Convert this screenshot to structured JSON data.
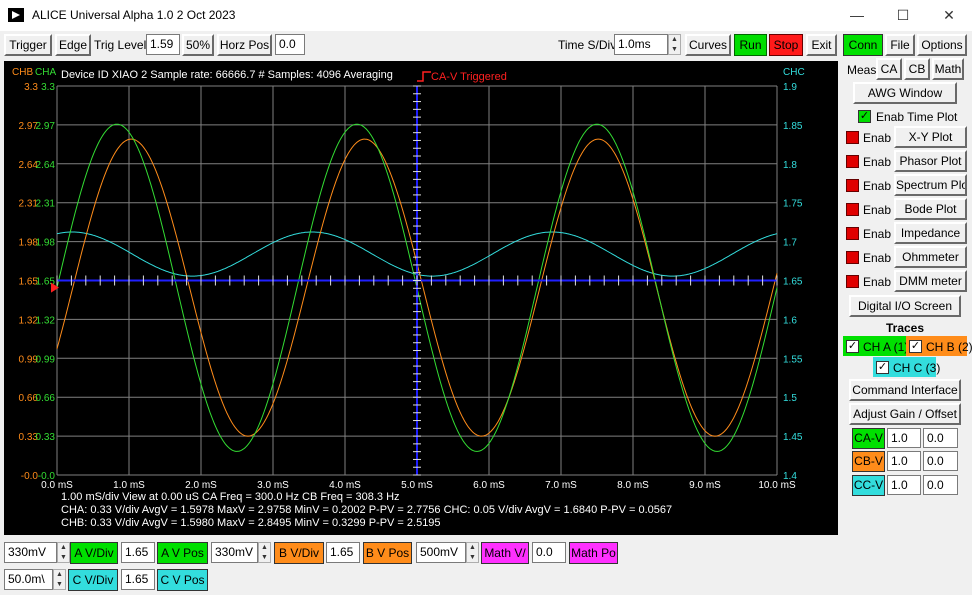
{
  "window": {
    "title": "ALICE Universal Alpha 1.0 2 Oct 2023",
    "min": "—",
    "max": "☐",
    "close": "✕"
  },
  "toolbar": {
    "trigger": "Trigger",
    "edge": "Edge",
    "trig_level_label": "Trig Level",
    "trig_level_value": "1.59",
    "fifty": "50%",
    "horz_pos_label": "Horz Pos",
    "horz_pos_value": "0.0",
    "time_div_label": "Time S/Div",
    "time_div_value": "1.0ms",
    "curves": "Curves",
    "run": "Run",
    "stop": "Stop",
    "exit": "Exit"
  },
  "scope": {
    "header": "Device ID XIAO 2 Sample rate:  66666.7  # Samples: 4096    Averaging",
    "triggered": "CA-V Triggered",
    "chb_label": "CHB",
    "cha_label": "CHA",
    "chc_label": "CHC",
    "left_ticks": [
      "3.3",
      "2.97",
      "2.64",
      "2.31",
      "1.98",
      "1.65",
      "1.32",
      "0.99",
      "0.66",
      "0.33",
      "-0.0"
    ],
    "right_ticks": [
      "1.9",
      "1.85",
      "1.8",
      "1.75",
      "1.7",
      "1.65",
      "1.6",
      "1.55",
      "1.5",
      "1.45",
      "1.4"
    ],
    "x_ticks": [
      "0.0  mS",
      "1.0  mS",
      "2.0  mS",
      "3.0  mS",
      "4.0  mS",
      "5.0  mS",
      "6.0  mS",
      "7.0  mS",
      "8.0  mS",
      "9.0  mS",
      "10.0  mS"
    ],
    "info1": "1.00  mS/div  View at  0.00  uS  CA Freq =  300.0  Hz  CB Freq =  308.3  Hz",
    "info2": "CHA: 0.33 V/div AvgV = 1.5978  MaxV = 2.9758  MinV = 0.2002  P-PV = 2.7756 CHC: 0.05 V/div AvgV = 1.6840  P-PV =  0.0567",
    "info3": "CHB: 0.33 V/div AvgV = 1.5980  MaxV = 2.8495  MinV = 0.3299  P-PV = 2.5195"
  },
  "colors": {
    "cha": "#33dd33",
    "chb": "#ff8c1a",
    "chc": "#33dddd",
    "grid": "#808080",
    "axis": "#2020ff",
    "trigger": "#ff2020"
  },
  "bottom": {
    "a_vdiv_value": "330mV",
    "a_vdiv": "A V/Div",
    "a_vpos_value": "1.65",
    "a_vpos": "A V Pos",
    "b_vdiv_value": "330mV",
    "b_vdiv": "B V/Div",
    "b_vpos_value": "1.65",
    "b_vpos": "B V Pos",
    "math_vdiv_value": "500mV",
    "math_vdiv": "Math V/",
    "math_pos_value": "0.0",
    "math_pos": "Math Po",
    "c_vdiv_value": "50.0m\\",
    "c_vdiv": "C V/Div",
    "c_vpos_value": "1.65",
    "c_vpos": "C V Pos"
  },
  "panel": {
    "tabs": [
      "Conn",
      "File",
      "Options"
    ],
    "meas": "Meas",
    "ca": "CA",
    "cb": "CB",
    "math": "Math",
    "awg": "AWG Window",
    "enab_time": "Enab Time Plot",
    "enab": "Enab",
    "plots": [
      "X-Y Plot",
      "Phasor Plot",
      "Spectrum Plo",
      "Bode Plot",
      "Impedance",
      "Ohmmeter",
      "DMM meter"
    ],
    "digital": "Digital I/O Screen",
    "traces": "Traces",
    "cha": "CH A (1)",
    "chb": "CH B (2)",
    "chc": "CH C (3)",
    "command": "Command Interface",
    "adjust": "Adjust Gain / Offset",
    "ca_v": "CA-V",
    "cb_v": "CB-V",
    "cc_v": "CC-V",
    "gain": "1.0",
    "offset": "0.0"
  },
  "chart_data": {
    "type": "line",
    "x_unit": "mS",
    "xlim": [
      0,
      10
    ],
    "series": [
      {
        "name": "CHA",
        "freq_hz": 300.0,
        "max_v": 2.9758,
        "min_v": 0.2002,
        "avg_v": 1.5978
      },
      {
        "name": "CHB",
        "freq_hz": 308.3,
        "max_v": 2.8495,
        "min_v": 0.3299,
        "avg_v": 1.598
      },
      {
        "name": "CHC",
        "avg_v": 1.684,
        "ppv": 0.0567
      }
    ],
    "left_ylim": [
      0,
      3.3
    ],
    "right_ylim": [
      1.4,
      1.9
    ],
    "trigger_level": 1.59
  }
}
